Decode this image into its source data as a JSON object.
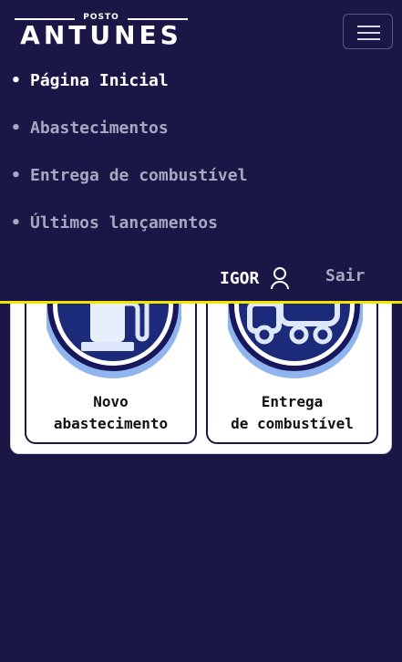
{
  "brand": {
    "top": "POSTO",
    "main": "ANTUNES"
  },
  "nav": {
    "items": [
      {
        "label": "Página Inicial"
      },
      {
        "label": "Abastecimentos"
      },
      {
        "label": "Entrega de combustível"
      },
      {
        "label": "Últimos lançamentos"
      }
    ],
    "bullet": "•"
  },
  "user": {
    "name": "IGOR",
    "logout": "Sair"
  },
  "cards": [
    {
      "line1": "Novo",
      "line2": "abastecimento",
      "icon": "fuel-pump-icon"
    },
    {
      "line1": "Entrega",
      "line2": "de combustível",
      "icon": "truck-icon"
    }
  ],
  "colors": {
    "background": "#1a1747",
    "accent": "#f2e600",
    "muted": "#a8a7c2"
  }
}
